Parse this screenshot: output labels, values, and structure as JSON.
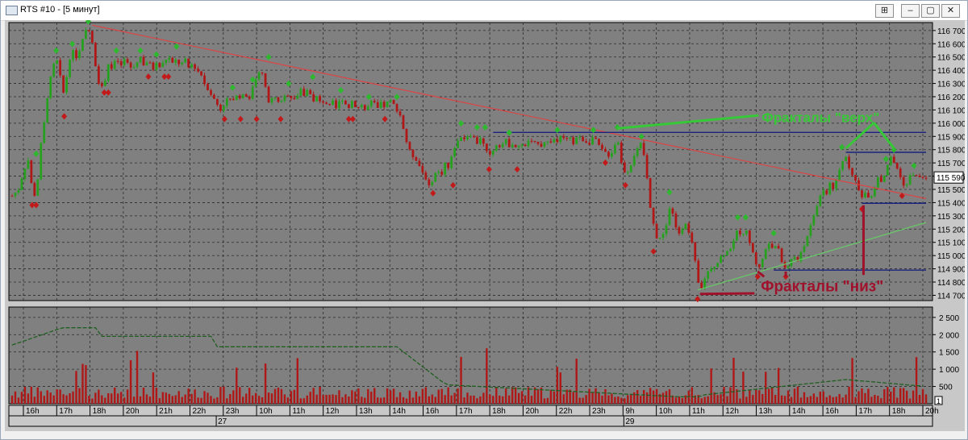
{
  "window": {
    "title": "RTS #10 - [5 минут]",
    "buttons": {
      "pin": "⊞",
      "minimize": "–",
      "restore": "▢",
      "close": "✕"
    }
  },
  "chart_data": {
    "type": "candlestick",
    "instrument": "RTS #10",
    "timeframe": "5 минут",
    "price_axis": {
      "ticks": [
        116700,
        116600,
        116500,
        116400,
        116300,
        116200,
        116100,
        116000,
        115900,
        115800,
        115700,
        115600,
        115500,
        115400,
        115300,
        115200,
        115100,
        115000,
        114900,
        114800,
        114700
      ],
      "ylim": [
        114660,
        116760
      ],
      "current_price": 115590,
      "current_label": "115 590"
    },
    "volume_axis": {
      "ticks": [
        2500,
        2000,
        1500,
        1000,
        500
      ],
      "ylim": [
        0,
        2800
      ],
      "scale_label": "1"
    },
    "time_axis": {
      "hours": [
        "16h",
        "17h",
        "18h",
        "20h",
        "21h",
        "22h",
        "23h",
        "10h",
        "11h",
        "12h",
        "13h",
        "14h",
        "16h",
        "17h",
        "18h",
        "20h",
        "22h",
        "23h",
        "9h",
        "10h",
        "11h",
        "12h",
        "13h",
        "14h",
        "16h",
        "17h",
        "18h",
        "20h"
      ],
      "dates": [
        "27",
        "29"
      ]
    },
    "price_path": [
      [
        0,
        115450
      ],
      [
        8,
        115500
      ],
      [
        15,
        115650
      ],
      [
        20,
        115720
      ],
      [
        25,
        115500
      ],
      [
        30,
        115430
      ],
      [
        35,
        115800
      ],
      [
        40,
        116000
      ],
      [
        45,
        116250
      ],
      [
        50,
        116400
      ],
      [
        55,
        116500
      ],
      [
        60,
        116350
      ],
      [
        65,
        116200
      ],
      [
        70,
        116450
      ],
      [
        75,
        116550
      ],
      [
        80,
        116500
      ],
      [
        85,
        116550
      ],
      [
        90,
        116680
      ],
      [
        95,
        116720
      ],
      [
        100,
        116600
      ],
      [
        105,
        116400
      ],
      [
        110,
        116250
      ],
      [
        115,
        116300
      ],
      [
        120,
        116450
      ],
      [
        125,
        116400
      ],
      [
        130,
        116500
      ],
      [
        135,
        116420
      ],
      [
        140,
        116480
      ],
      [
        145,
        116450
      ],
      [
        150,
        116400
      ],
      [
        155,
        116460
      ],
      [
        160,
        116500
      ],
      [
        165,
        116430
      ],
      [
        170,
        116480
      ],
      [
        175,
        116400
      ],
      [
        180,
        116450
      ],
      [
        185,
        116420
      ],
      [
        190,
        116470
      ],
      [
        195,
        116500
      ],
      [
        200,
        116450
      ],
      [
        205,
        116480
      ],
      [
        210,
        116430
      ],
      [
        215,
        116490
      ],
      [
        220,
        116420
      ],
      [
        225,
        116450
      ],
      [
        230,
        116400
      ],
      [
        235,
        116380
      ],
      [
        240,
        116300
      ],
      [
        245,
        116250
      ],
      [
        250,
        116200
      ],
      [
        255,
        116150
      ],
      [
        260,
        116100
      ],
      [
        265,
        116150
      ],
      [
        270,
        116200
      ],
      [
        275,
        116150
      ],
      [
        280,
        116220
      ],
      [
        285,
        116180
      ],
      [
        290,
        116250
      ],
      [
        295,
        116150
      ],
      [
        300,
        116280
      ],
      [
        305,
        116350
      ],
      [
        310,
        116420
      ],
      [
        315,
        116300
      ],
      [
        320,
        116150
      ],
      [
        325,
        116200
      ],
      [
        330,
        116180
      ],
      [
        335,
        116150
      ],
      [
        340,
        116200
      ],
      [
        345,
        116220
      ],
      [
        350,
        116180
      ],
      [
        355,
        116200
      ],
      [
        360,
        116250
      ],
      [
        365,
        116200
      ],
      [
        370,
        116280
      ],
      [
        375,
        116150
      ],
      [
        380,
        116200
      ],
      [
        385,
        116150
      ],
      [
        390,
        116170
      ],
      [
        395,
        116120
      ],
      [
        400,
        116160
      ],
      [
        405,
        116100
      ],
      [
        410,
        116200
      ],
      [
        415,
        116150
      ],
      [
        420,
        116120
      ],
      [
        425,
        116180
      ],
      [
        430,
        116100
      ],
      [
        435,
        116150
      ],
      [
        440,
        116100
      ],
      [
        445,
        116130
      ],
      [
        450,
        116180
      ],
      [
        455,
        116100
      ],
      [
        460,
        116150
      ],
      [
        465,
        116120
      ],
      [
        470,
        116180
      ],
      [
        475,
        116150
      ],
      [
        480,
        116100
      ],
      [
        485,
        116050
      ],
      [
        490,
        115900
      ],
      [
        495,
        115800
      ],
      [
        500,
        115750
      ],
      [
        505,
        115720
      ],
      [
        510,
        115650
      ],
      [
        515,
        115600
      ],
      [
        520,
        115520
      ],
      [
        525,
        115580
      ],
      [
        530,
        115650
      ],
      [
        535,
        115600
      ],
      [
        540,
        115700
      ],
      [
        545,
        115650
      ],
      [
        550,
        115800
      ],
      [
        555,
        115850
      ],
      [
        560,
        115900
      ],
      [
        565,
        115880
      ],
      [
        570,
        115920
      ],
      [
        575,
        115900
      ],
      [
        580,
        115850
      ],
      [
        585,
        115900
      ],
      [
        590,
        115800
      ],
      [
        595,
        115750
      ],
      [
        600,
        115800
      ],
      [
        605,
        115850
      ],
      [
        610,
        115820
      ],
      [
        615,
        115880
      ],
      [
        620,
        115830
      ],
      [
        625,
        115850
      ],
      [
        630,
        115800
      ],
      [
        635,
        115850
      ],
      [
        640,
        115820
      ],
      [
        645,
        115880
      ],
      [
        650,
        115840
      ],
      [
        655,
        115860
      ],
      [
        660,
        115830
      ],
      [
        665,
        115870
      ],
      [
        670,
        115850
      ],
      [
        675,
        115880
      ],
      [
        680,
        115860
      ],
      [
        685,
        115900
      ],
      [
        690,
        115870
      ],
      [
        695,
        115890
      ],
      [
        700,
        115850
      ],
      [
        705,
        115900
      ],
      [
        710,
        115880
      ],
      [
        715,
        115860
      ],
      [
        720,
        115850
      ],
      [
        725,
        115900
      ],
      [
        730,
        115850
      ],
      [
        735,
        115800
      ],
      [
        740,
        115780
      ],
      [
        745,
        115750
      ],
      [
        750,
        115800
      ],
      [
        755,
        115900
      ],
      [
        760,
        115700
      ],
      [
        765,
        115620
      ],
      [
        770,
        115650
      ],
      [
        775,
        115750
      ],
      [
        780,
        115800
      ],
      [
        785,
        115850
      ],
      [
        790,
        115700
      ],
      [
        795,
        115400
      ],
      [
        800,
        115250
      ],
      [
        805,
        115100
      ],
      [
        810,
        115150
      ],
      [
        815,
        115200
      ],
      [
        820,
        115350
      ],
      [
        825,
        115300
      ],
      [
        830,
        115150
      ],
      [
        835,
        115200
      ],
      [
        840,
        115250
      ],
      [
        845,
        115150
      ],
      [
        850,
        115050
      ],
      [
        855,
        114800
      ],
      [
        860,
        114750
      ],
      [
        865,
        114850
      ],
      [
        870,
        114900
      ],
      [
        875,
        114920
      ],
      [
        880,
        114950
      ],
      [
        885,
        115000
      ],
      [
        890,
        115020
      ],
      [
        895,
        115050
      ],
      [
        900,
        115100
      ],
      [
        905,
        115200
      ],
      [
        910,
        115150
      ],
      [
        915,
        115200
      ],
      [
        920,
        115100
      ],
      [
        925,
        115000
      ],
      [
        930,
        114900
      ],
      [
        935,
        114950
      ],
      [
        940,
        115050
      ],
      [
        945,
        115100
      ],
      [
        950,
        115050
      ],
      [
        955,
        115080
      ],
      [
        960,
        114950
      ],
      [
        965,
        114900
      ],
      [
        970,
        114950
      ],
      [
        975,
        115000
      ],
      [
        980,
        114950
      ],
      [
        985,
        115050
      ],
      [
        990,
        115100
      ],
      [
        995,
        115200
      ],
      [
        1000,
        115300
      ],
      [
        1005,
        115400
      ],
      [
        1010,
        115500
      ],
      [
        1015,
        115450
      ],
      [
        1020,
        115550
      ],
      [
        1025,
        115500
      ],
      [
        1030,
        115600
      ],
      [
        1035,
        115700
      ],
      [
        1040,
        115750
      ],
      [
        1045,
        115650
      ],
      [
        1050,
        115600
      ],
      [
        1055,
        115500
      ],
      [
        1060,
        115450
      ],
      [
        1065,
        115480
      ],
      [
        1070,
        115430
      ],
      [
        1075,
        115500
      ],
      [
        1080,
        115600
      ],
      [
        1085,
        115550
      ],
      [
        1090,
        115650
      ],
      [
        1095,
        115750
      ],
      [
        1100,
        115700
      ],
      [
        1105,
        115650
      ],
      [
        1110,
        115550
      ],
      [
        1115,
        115520
      ],
      [
        1120,
        115600
      ],
      [
        1125,
        115620
      ],
      [
        1130,
        115580
      ],
      [
        1135,
        115590
      ],
      [
        1140,
        115590
      ]
    ],
    "fractals_up": [
      [
        30,
        115720
      ],
      [
        55,
        116500
      ],
      [
        75,
        116550
      ],
      [
        95,
        116720
      ],
      [
        130,
        116500
      ],
      [
        160,
        116500
      ],
      [
        180,
        116470
      ],
      [
        205,
        116530
      ],
      [
        275,
        116220
      ],
      [
        300,
        116280
      ],
      [
        320,
        116450
      ],
      [
        345,
        116250
      ],
      [
        375,
        116300
      ],
      [
        410,
        116200
      ],
      [
        445,
        116150
      ],
      [
        480,
        116150
      ],
      [
        560,
        115950
      ],
      [
        580,
        115920
      ],
      [
        590,
        115920
      ],
      [
        620,
        115880
      ],
      [
        680,
        115900
      ],
      [
        725,
        115900
      ],
      [
        755,
        115920
      ],
      [
        785,
        115850
      ],
      [
        820,
        115430
      ],
      [
        905,
        115240
      ],
      [
        915,
        115240
      ],
      [
        950,
        115120
      ],
      [
        1035,
        115770
      ],
      [
        1090,
        115680
      ],
      [
        1100,
        115750
      ],
      [
        1125,
        115630
      ]
    ],
    "fractals_down": [
      [
        25,
        115430
      ],
      [
        30,
        115430
      ],
      [
        65,
        116100
      ],
      [
        115,
        116280
      ],
      [
        120,
        116280
      ],
      [
        170,
        116400
      ],
      [
        190,
        116400
      ],
      [
        195,
        116400
      ],
      [
        265,
        116080
      ],
      [
        285,
        116080
      ],
      [
        305,
        116080
      ],
      [
        335,
        116080
      ],
      [
        420,
        116080
      ],
      [
        425,
        116080
      ],
      [
        465,
        116080
      ],
      [
        525,
        115520
      ],
      [
        550,
        115580
      ],
      [
        595,
        115700
      ],
      [
        630,
        115700
      ],
      [
        740,
        115750
      ],
      [
        765,
        115580
      ],
      [
        800,
        115080
      ],
      [
        855,
        114720
      ],
      [
        930,
        114890
      ],
      [
        965,
        114890
      ],
      [
        1060,
        115400
      ],
      [
        1110,
        115500
      ]
    ],
    "trendlines": [
      {
        "color": "#d44",
        "points": [
          [
            100,
            116740
          ],
          [
            1140,
            115430
          ]
        ]
      },
      {
        "color": "#6c6",
        "points": [
          [
            855,
            114740
          ],
          [
            1140,
            115250
          ]
        ]
      }
    ],
    "levels": [
      {
        "color": "#1a237e",
        "price": 115930,
        "from": 600,
        "to": 1140
      },
      {
        "color": "#1a237e",
        "price": 115780,
        "from": 1040,
        "to": 1140
      },
      {
        "color": "#1a237e",
        "price": 115395,
        "from": 1060,
        "to": 1140
      },
      {
        "color": "#1a237e",
        "price": 114890,
        "from": 950,
        "to": 1140
      }
    ],
    "annotations": [
      {
        "text": "Фракталы \"верх\"",
        "color": "#37c837",
        "price": 116040,
        "x": 935
      },
      {
        "text": "Фракталы \"низ\"",
        "color": "#a0122c",
        "price": 114780,
        "x": 930
      }
    ],
    "colors": {
      "bull": "#27a020",
      "bear": "#b01818",
      "background": "#808080",
      "grid": "#2a2a2a"
    }
  }
}
